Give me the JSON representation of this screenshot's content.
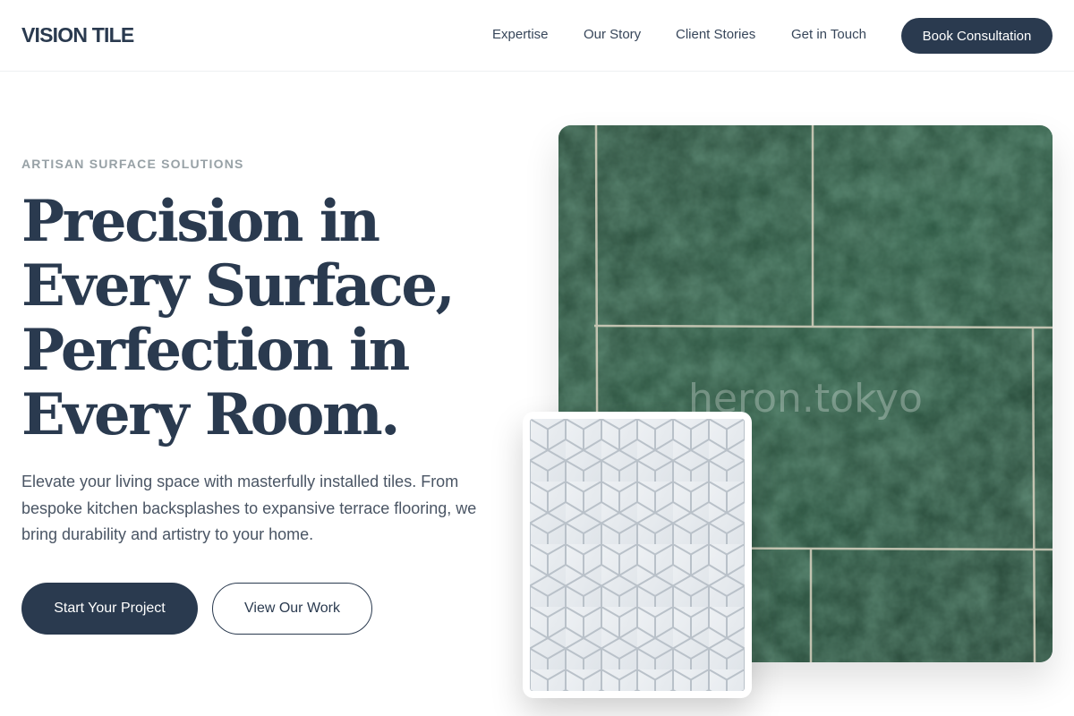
{
  "header": {
    "brand": "VISION TILE",
    "nav": [
      "Expertise",
      "Our Story",
      "Client Stories",
      "Get in Touch"
    ],
    "cta": "Book Consultation"
  },
  "hero": {
    "eyebrow": "ARTISAN SURFACE SOLUTIONS",
    "headline_lines": [
      "Precision in",
      "Every Surface,",
      "Perfection in",
      "Every Room."
    ],
    "description": "Elevate your living space with masterfully installed tiles. From bespoke kitchen backsplashes to expansive terrace flooring, we bring durability and artistry to your home.",
    "primary_button": "Start Your Project",
    "secondary_button": "View Our Work"
  },
  "images": {
    "main": {
      "subject": "green marble tile floor",
      "watermark": "heron.tokyo"
    },
    "secondary": {
      "subject": "white rhombus mosaic tiles"
    }
  },
  "colors": {
    "primary": "#2a3a4f",
    "eyebrow": "#97a1a6",
    "body_text": "#4a5564",
    "marble": "#1f3f2e"
  }
}
